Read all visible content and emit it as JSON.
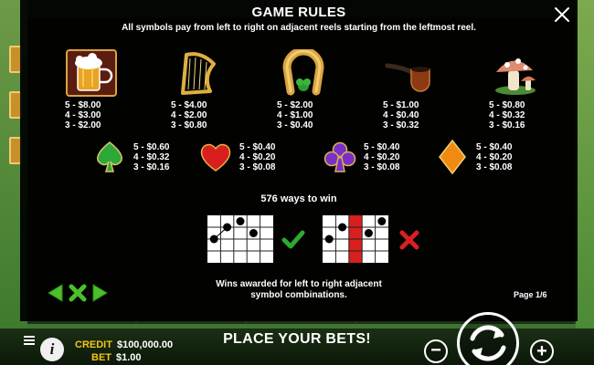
{
  "modal": {
    "title": "GAME RULES",
    "subtitle": "All symbols pay from left to right on adjacent reels starting from the leftmost reel.",
    "close_icon": "close-icon"
  },
  "symbols_high": [
    {
      "name": "beer",
      "icon": "beer-mug-icon",
      "pays": [
        "5 - $8.00",
        "4 - $3.00",
        "3 - $2.00"
      ]
    },
    {
      "name": "harp",
      "icon": "harp-icon",
      "pays": [
        "5 - $4.00",
        "4 - $2.00",
        "3 - $0.80"
      ]
    },
    {
      "name": "horseshoe",
      "icon": "horseshoe-icon",
      "pays": [
        "5 - $2.00",
        "4 - $1.00",
        "3 - $0.40"
      ]
    },
    {
      "name": "pipe",
      "icon": "pipe-icon",
      "pays": [
        "5 - $1.00",
        "4 - $0.40",
        "3 - $0.32"
      ]
    },
    {
      "name": "mushroom",
      "icon": "mushroom-icon",
      "pays": [
        "5 - $0.80",
        "4 - $0.32",
        "3 - $0.16"
      ]
    }
  ],
  "symbols_low": [
    {
      "name": "spade",
      "icon": "spade-icon",
      "color": "#2fa83a",
      "pays": [
        "5 - $0.60",
        "4 - $0.32",
        "3 - $0.16"
      ]
    },
    {
      "name": "heart",
      "icon": "heart-icon",
      "color": "#d81e1e",
      "pays": [
        "5 - $0.40",
        "4 - $0.20",
        "3 - $0.08"
      ]
    },
    {
      "name": "club",
      "icon": "club-icon",
      "color": "#7a2fc8",
      "pays": [
        "5 - $0.40",
        "4 - $0.20",
        "3 - $0.08"
      ]
    },
    {
      "name": "diamond",
      "icon": "diamond-icon",
      "color": "#f08a12",
      "pays": [
        "5 - $0.40",
        "4 - $0.20",
        "3 - $0.08"
      ]
    }
  ],
  "ways": {
    "label": "576 ways to win",
    "valid_icon": "checkmark-icon",
    "invalid_icon": "cross-icon"
  },
  "wins_note": {
    "line1": "Wins awarded for left to right adjacent",
    "line2": "symbol combinations."
  },
  "page_indicator": "Page 1/6",
  "nav": {
    "prev_icon": "arrow-left-icon",
    "close_icon": "x-close-icon",
    "next_icon": "arrow-right-icon"
  },
  "bottom_bar": {
    "credit_label": "CREDIT",
    "credit_value": "$100,000.00",
    "bet_label": "BET",
    "bet_value": "$1.00",
    "banner": "PLACE YOUR BETS!",
    "info_icon": "info-icon",
    "menu_icon": "menu-icon",
    "info_label": "i",
    "minus_label": "−",
    "plus_label": "+"
  },
  "colors": {
    "accent_yellow": "#f5c518",
    "check_green": "#2ea82e",
    "cross_red": "#d8201e"
  }
}
